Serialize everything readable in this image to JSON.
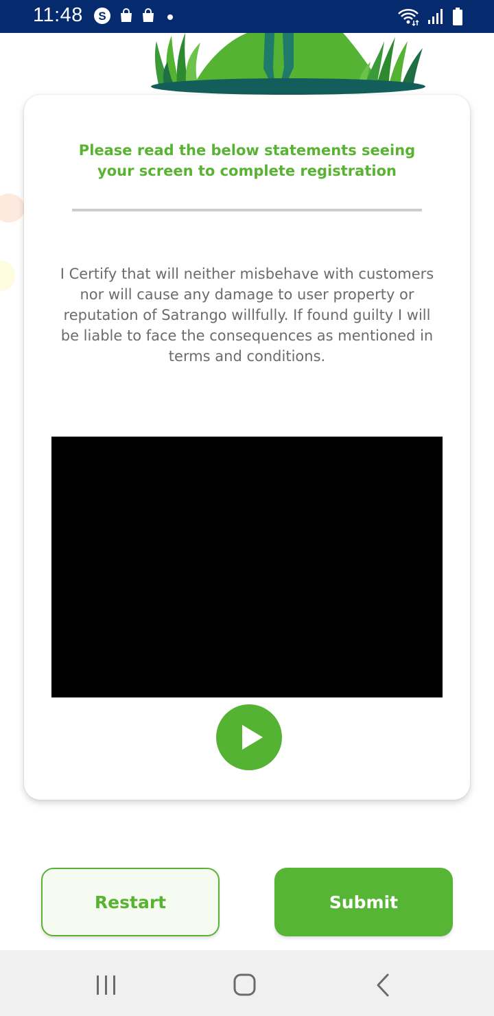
{
  "status_bar": {
    "time": "11:48",
    "left_icons": [
      "skype-icon",
      "shopping-bag-icon",
      "shopping-bag-icon",
      "dot-icon"
    ],
    "right_icons": [
      "wifi-icon",
      "signal-icon",
      "battery-icon"
    ]
  },
  "card": {
    "title": "Please read the below statements seeing your screen to complete registration",
    "statement": "I Certify that will neither misbehave with customers nor will cause any damage to user property or reputation of Satrango willfully. If found guilty I will be liable to face the consequences as mentioned in terms and conditions.",
    "play_icon": "play-icon"
  },
  "actions": {
    "restart_label": "Restart",
    "submit_label": "Submit"
  },
  "nav": {
    "icons": [
      "recent-apps-icon",
      "home-icon",
      "back-icon"
    ]
  },
  "colors": {
    "accent_green": "#59b332",
    "status_bar": "#062a6e",
    "text_gray": "#6b6b6b"
  }
}
